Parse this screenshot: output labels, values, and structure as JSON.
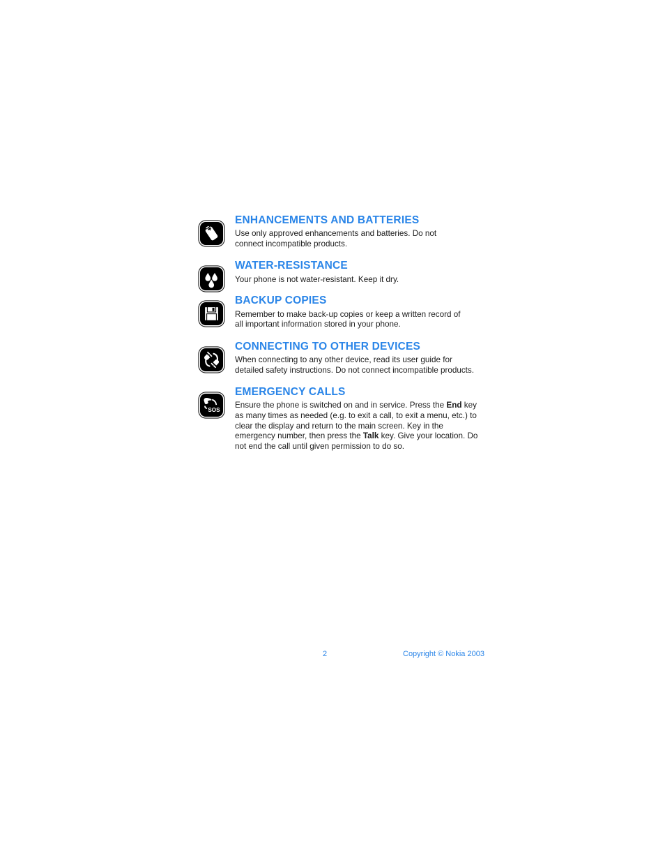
{
  "document": {
    "type": "user-guide-safety-page",
    "background_color": "#ffffff",
    "accent_color": "#2a85e8",
    "body_text_color": "#1c1c1c"
  },
  "notices": [
    {
      "icon": "battery-icon",
      "title": "ENHANCEMENTS AND BATTERIES",
      "body": "Use only approved enhancements and batteries. Do not connect incompatible products."
    },
    {
      "icon": "water-drops-icon",
      "title": "WATER-RESISTANCE",
      "body": "Your phone is not water-resistant. Keep it dry."
    },
    {
      "icon": "floppy-disk-icon",
      "title": "BACKUP COPIES",
      "body": "Remember to make back-up copies or keep a written record of all important information stored in your phone."
    },
    {
      "icon": "plug-cable-icon",
      "title": "CONNECTING TO OTHER DEVICES",
      "body": "When connecting to any other device, read its user guide for detailed safety instructions. Do not connect incompatible products."
    },
    {
      "icon": "phone-sos-icon",
      "title": "EMERGENCY CALLS",
      "body_parts": [
        {
          "text": "Ensure the phone is switched on and in service. Press the ",
          "bold": false
        },
        {
          "text": "End",
          "bold": true
        },
        {
          "text": " key as many times as needed (e.g. to exit a call, to exit a menu, etc.) to clear the display and return to the main screen. Key in the emergency number, then press the ",
          "bold": false
        },
        {
          "text": "Talk",
          "bold": true
        },
        {
          "text": " key. Give your location. Do not end the call until given permission to do so.",
          "bold": false
        }
      ]
    }
  ],
  "footer": {
    "page_number": "2",
    "copyright": "Copyright © Nokia 2003"
  },
  "icon_glyph_labels": {
    "battery-icon": "battery with plus terminal",
    "water-drops-icon": "three water droplets",
    "floppy-disk-icon": "floppy diskette",
    "plug-cable-icon": "electrical plug and cable",
    "phone-sos-icon": "telephone handset with SOS"
  }
}
